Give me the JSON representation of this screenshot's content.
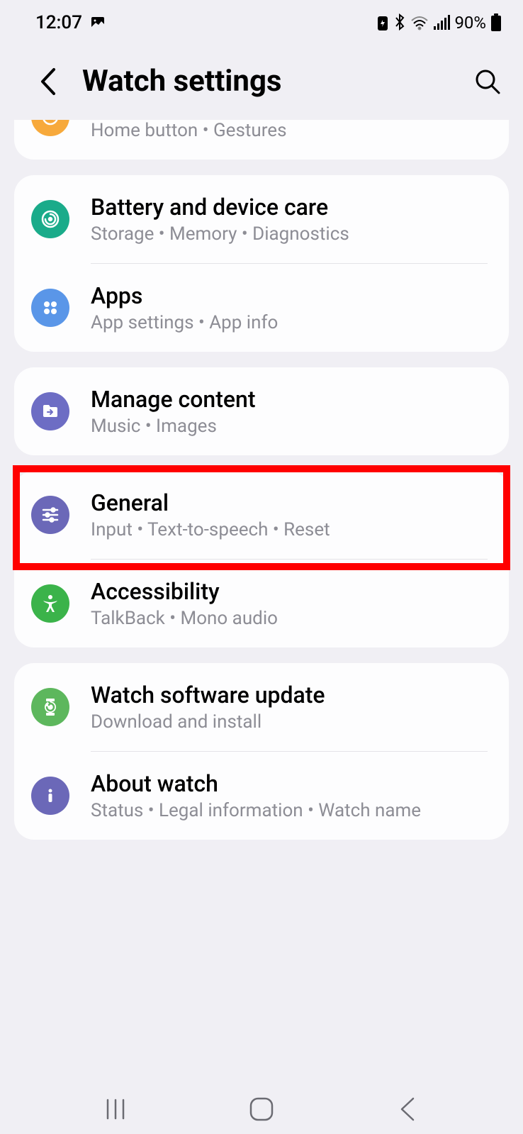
{
  "statusBar": {
    "time": "12:07",
    "battery": "90%"
  },
  "header": {
    "title": "Watch settings"
  },
  "groups": [
    {
      "partial": true,
      "items": [
        {
          "iconColor": "icon-orange",
          "iconName": "home-gesture-icon",
          "title": "",
          "subtitle": "Home button • Gestures",
          "partialTop": true
        }
      ]
    },
    {
      "items": [
        {
          "iconColor": "icon-teal",
          "iconName": "device-care-icon",
          "title": "Battery and device care",
          "subtitle": "Storage • Memory • Diagnostics"
        },
        {
          "iconColor": "icon-blue",
          "iconName": "apps-icon",
          "title": "Apps",
          "subtitle": "App settings • App info"
        }
      ]
    },
    {
      "items": [
        {
          "iconColor": "icon-purple",
          "iconName": "folder-arrow-icon",
          "title": "Manage content",
          "subtitle": "Music • Images"
        }
      ]
    },
    {
      "items": [
        {
          "iconColor": "icon-dpurple",
          "iconName": "sliders-icon",
          "title": "General",
          "subtitle": "Input • Text-to-speech • Reset",
          "highlight": true
        },
        {
          "iconColor": "icon-green",
          "iconName": "accessibility-icon",
          "title": "Accessibility",
          "subtitle": "TalkBack • Mono audio"
        }
      ]
    },
    {
      "items": [
        {
          "iconColor": "icon-lgreen",
          "iconName": "update-icon",
          "title": "Watch software update",
          "subtitle": "Download and install"
        },
        {
          "iconColor": "icon-info",
          "iconName": "info-icon",
          "title": "About watch",
          "subtitle": "Status • Legal information • Watch name"
        }
      ]
    }
  ]
}
